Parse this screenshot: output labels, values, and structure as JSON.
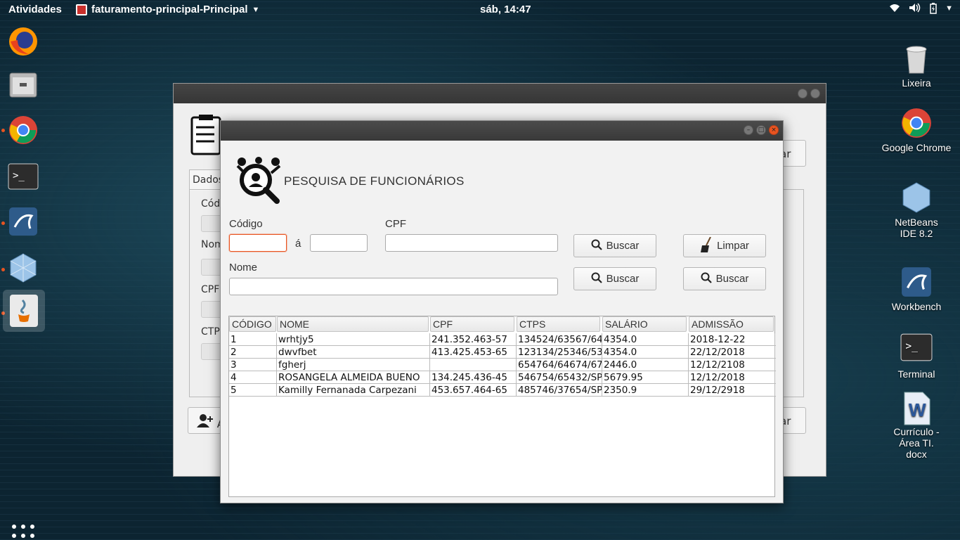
{
  "topbar": {
    "activities": "Atividades",
    "app_name": "faturamento-principal-Principal",
    "clock": "sáb, 14:47"
  },
  "dock": {
    "items": [
      "firefox-icon",
      "files-icon",
      "chrome-icon",
      "terminal-icon",
      "mysql-workbench-icon",
      "netbeans-icon",
      "java-icon"
    ]
  },
  "desktop": {
    "icons": [
      {
        "label": "Lixeira"
      },
      {
        "label": "Google Chrome"
      },
      {
        "label": "NetBeans IDE 8.2"
      },
      {
        "label": "Workbench"
      },
      {
        "label": "Terminal"
      },
      {
        "label": "Currículo - Área TI. docx"
      }
    ]
  },
  "bg_window": {
    "tab_label": "Dados",
    "labels": {
      "codigo": "Cód",
      "nome": "Nom",
      "cpf": "CPF",
      "ctps": "CTP"
    },
    "right_btn_partial": "ar",
    "bottom_btn_partial": "A",
    "bottom_right_partial": "ar"
  },
  "dialog": {
    "title": "PESQUISA DE FUNCIONÁRIOS",
    "labels": {
      "codigo": "Código",
      "a": "á",
      "cpf": "CPF",
      "nome": "Nome"
    },
    "inputs": {
      "codigo_from": "",
      "codigo_to": "",
      "cpf": "",
      "nome": ""
    },
    "buttons": {
      "buscar_cpf": "Buscar",
      "limpar": "Limpar",
      "buscar_nome": "Buscar",
      "buscar_all": "Buscar"
    },
    "table": {
      "columns": [
        "CÓDIGO",
        "NOME",
        "CPF",
        "CTPS",
        "SALÁRIO",
        "ADMISSÃO"
      ],
      "rows": [
        [
          "1",
          "wrhtjy5",
          "241.352.463-57",
          "134524/63567/64",
          "4354.0",
          "2018-12-22"
        ],
        [
          "2",
          "dwvfbet",
          "413.425.453-65",
          "123134/25346/53",
          "4354.0",
          "22/12/2018"
        ],
        [
          "3",
          "fgherj",
          "",
          "654764/64674/67",
          "2446.0",
          "12/12/2108"
        ],
        [
          "4",
          "ROSANGELA ALMEIDA BUENO",
          "134.245.436-45",
          "546754/65432/SP",
          "5679.95",
          "12/12/2018"
        ],
        [
          "5",
          "Kamilly Fernanada Carpezani",
          "453.657.464-65",
          "485746/37654/SP",
          "2350.9",
          "29/12/2918"
        ]
      ]
    }
  },
  "colors": {
    "accent": "#e95420",
    "dialog_bg": "#f2f2f2",
    "titlebar": "#3c3c3c"
  }
}
